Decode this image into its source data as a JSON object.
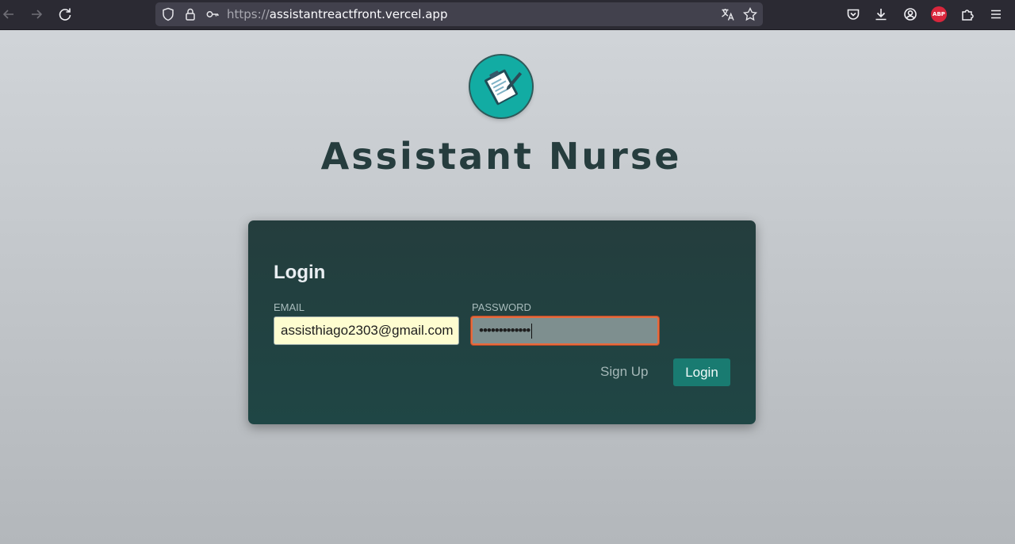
{
  "browser": {
    "url_scheme": "https://",
    "url_host": "assistantreactfront.vercel.app",
    "abp_label": "ABP",
    "icons": [
      "back-icon",
      "forward-icon",
      "reload-icon",
      "shield-icon",
      "lock-icon",
      "key-icon",
      "translate-icon",
      "star-icon",
      "pocket-icon",
      "download-icon",
      "account-icon",
      "extensions-icon",
      "menu-icon"
    ]
  },
  "page": {
    "site_title": "Assistant Nurse",
    "logo_icon": "clipboard-icon",
    "accent_color": "#12aca3"
  },
  "login": {
    "title": "Login",
    "email_label": "EMAIL",
    "email_value": "assisthiago2303@gmail.com",
    "password_label": "PASSWORD",
    "password_value": "•••••••••••••",
    "signup_label": "Sign Up",
    "submit_label": "Login"
  }
}
